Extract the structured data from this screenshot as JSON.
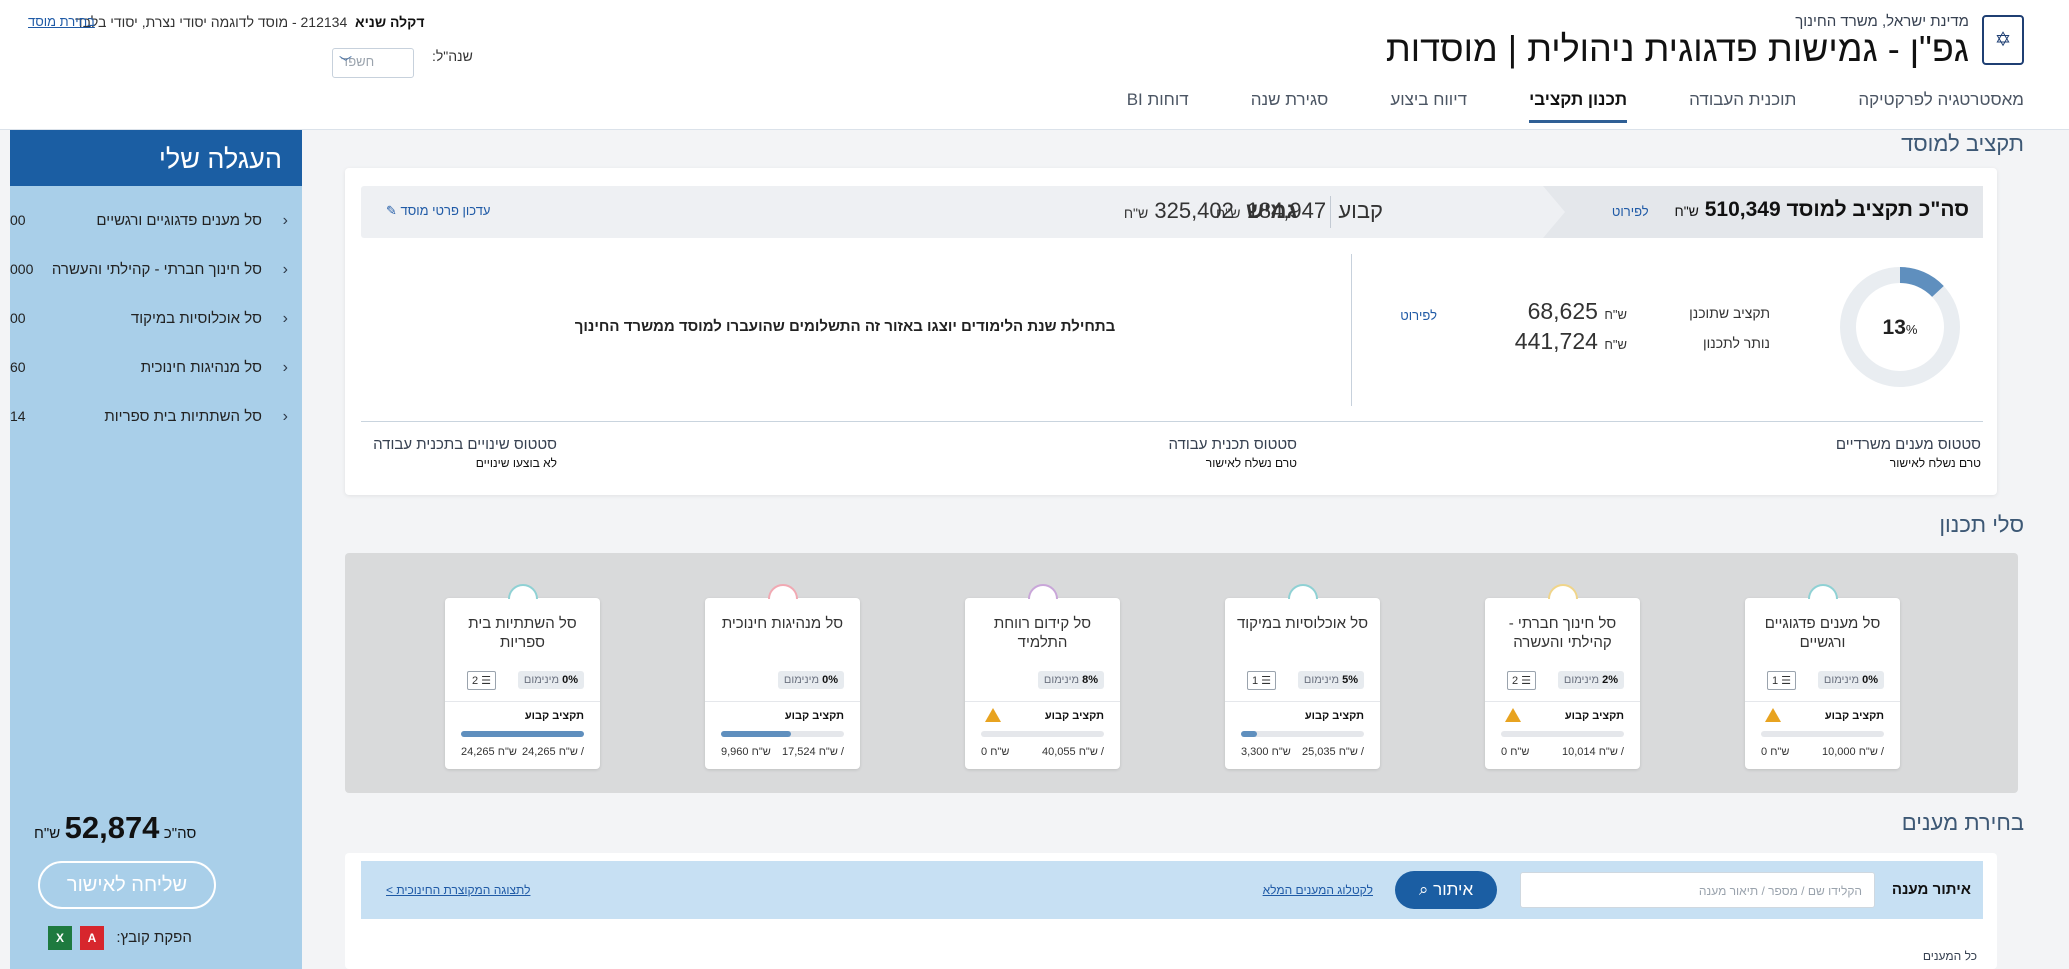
{
  "header": {
    "ministry": "מדינת ישראל, משרד החינוך",
    "title": "גפ\"ן - גמישות פדגוגית ניהולית | מוסדות",
    "institution_prefix": "דקלה שניא",
    "institution_rest": "212134 - מוסד לדוגמה יסודי נצרת, יסודי בלבד",
    "change_institution": "בחירת מוסד",
    "year_label": "שנה\"ל:",
    "year_value": "חשפד"
  },
  "tabs": [
    {
      "label": "מאסטרטגיה לפרקטיקה",
      "active": false
    },
    {
      "label": "תוכנית העבודה",
      "active": false
    },
    {
      "label": "תכנון תקציבי",
      "active": true
    },
    {
      "label": "דיווח ביצוע",
      "active": false
    },
    {
      "label": "סגירת שנה",
      "active": false
    },
    {
      "label": "דוחות BI",
      "active": false
    }
  ],
  "cart": {
    "title": "העגלה שלי",
    "items": [
      {
        "label": "סל מענים פדגוגיים ורגשיים",
        "amount": "00"
      },
      {
        "label": "סל חינוך חברתי - קהילתי והעשרה",
        "amount": "000"
      },
      {
        "label": "סל אוכלוסיות במיקוד",
        "amount": "00"
      },
      {
        "label": "סל מנהיגות חינוכית",
        "amount": "60"
      },
      {
        "label": "סל השתתיות בית ספריות",
        "amount": "14"
      }
    ],
    "total_label": "סה\"כ",
    "total_value": "52,874",
    "total_currency": "ש\"ח",
    "send_button": "שליחה לאישור",
    "export_label": "הפקת קובץ:",
    "xls_icon_text": "X",
    "pdf_icon_text": "A"
  },
  "budget": {
    "section_title": "תקציב למוסד",
    "total_label": "סה\"כ תקציב למוסד",
    "total_value": "510,349",
    "currency": "ש\"ח",
    "details_link": "לפירוט",
    "fixed_label": "קבוע",
    "fixed_value": "184,947",
    "flexible_label": "גמיש",
    "flexible_value": "325,402",
    "edit_link": "עדכון פרטי מוסד",
    "donut_percent": 13,
    "donut_suffix": "%",
    "current_budget_label": "תקציב שתוכנן",
    "current_budget_value": "68,625",
    "remaining_label": "נותר לתכנון",
    "remaining_value": "441,724",
    "breakdown_link": "לפירוט",
    "info_text": "בתחילת שנת הלימודים יוצגו באזור זה התשלומים שהועברו למוסד ממשרד החינוך",
    "statuses": [
      {
        "title": "סטטוס מענים משרדיים",
        "sub": "טרם נשלח לאישור"
      },
      {
        "title": "סטטוס תכנית עבודה",
        "sub": "טרם נשלח לאישור"
      },
      {
        "title": "סטטוס שינויים בתכנית עבודה",
        "sub": "לא בוצעו שינויים"
      }
    ]
  },
  "planning": {
    "section_title": "סלי תכנון",
    "budget_label": "תקציב קבוע",
    "colors": {
      "warn": "#e8a320",
      "bar": "#5f8fbe"
    },
    "baskets": [
      {
        "name": "סל מענים פדגוגיים ורגשיים",
        "percent": "0%",
        "min_label": "מינימום",
        "count": "1",
        "warn": true,
        "used": "0",
        "total": "10,000",
        "fill": 0,
        "circle": "#8fd1d4"
      },
      {
        "name": "סל חינוך חברתי - קהילתי והעשרה",
        "percent": "2%",
        "min_label": "מינימום",
        "count": "2",
        "warn": true,
        "used": "0",
        "total": "10,014",
        "fill": 0,
        "circle": "#f0d58a"
      },
      {
        "name": "סל אוכלוסיות במיקוד",
        "percent": "5%",
        "min_label": "מינימום",
        "count": "1",
        "warn": false,
        "used": "3,300",
        "total": "25,035",
        "fill": 0.13,
        "circle": "#8fd1d4"
      },
      {
        "name": "סל קידום רווחת התלמיד",
        "percent": "8%",
        "min_label": "מינימום",
        "count": "",
        "warn": true,
        "used": "0",
        "total": "40,055",
        "fill": 0,
        "circle": "#c9a6d9"
      },
      {
        "name": "סל מנהיגות חינוכית",
        "percent": "0%",
        "min_label": "מינימום",
        "count": "",
        "warn": false,
        "used": "9,960",
        "total": "17,524",
        "fill": 0.57,
        "circle": "#f1a9b3"
      },
      {
        "name": "סל השתתיות בית ספריות",
        "percent": "0%",
        "min_label": "מינימום",
        "count": "2",
        "warn": false,
        "used": "24,265",
        "total": "24,265",
        "fill": 1,
        "circle": "#8fd1d4"
      }
    ]
  },
  "responses": {
    "section_title": "בחירת מענים",
    "filter_label": "איתור מענה",
    "search_placeholder": "הקלידו שם / מספר / תיאור מענה",
    "search_button": "איתור",
    "catalog_link": "לקטלוג המענים המלא",
    "nav_link": "לתצוגה המקוצרת החינוכית >",
    "all_label": "כל המענים"
  }
}
